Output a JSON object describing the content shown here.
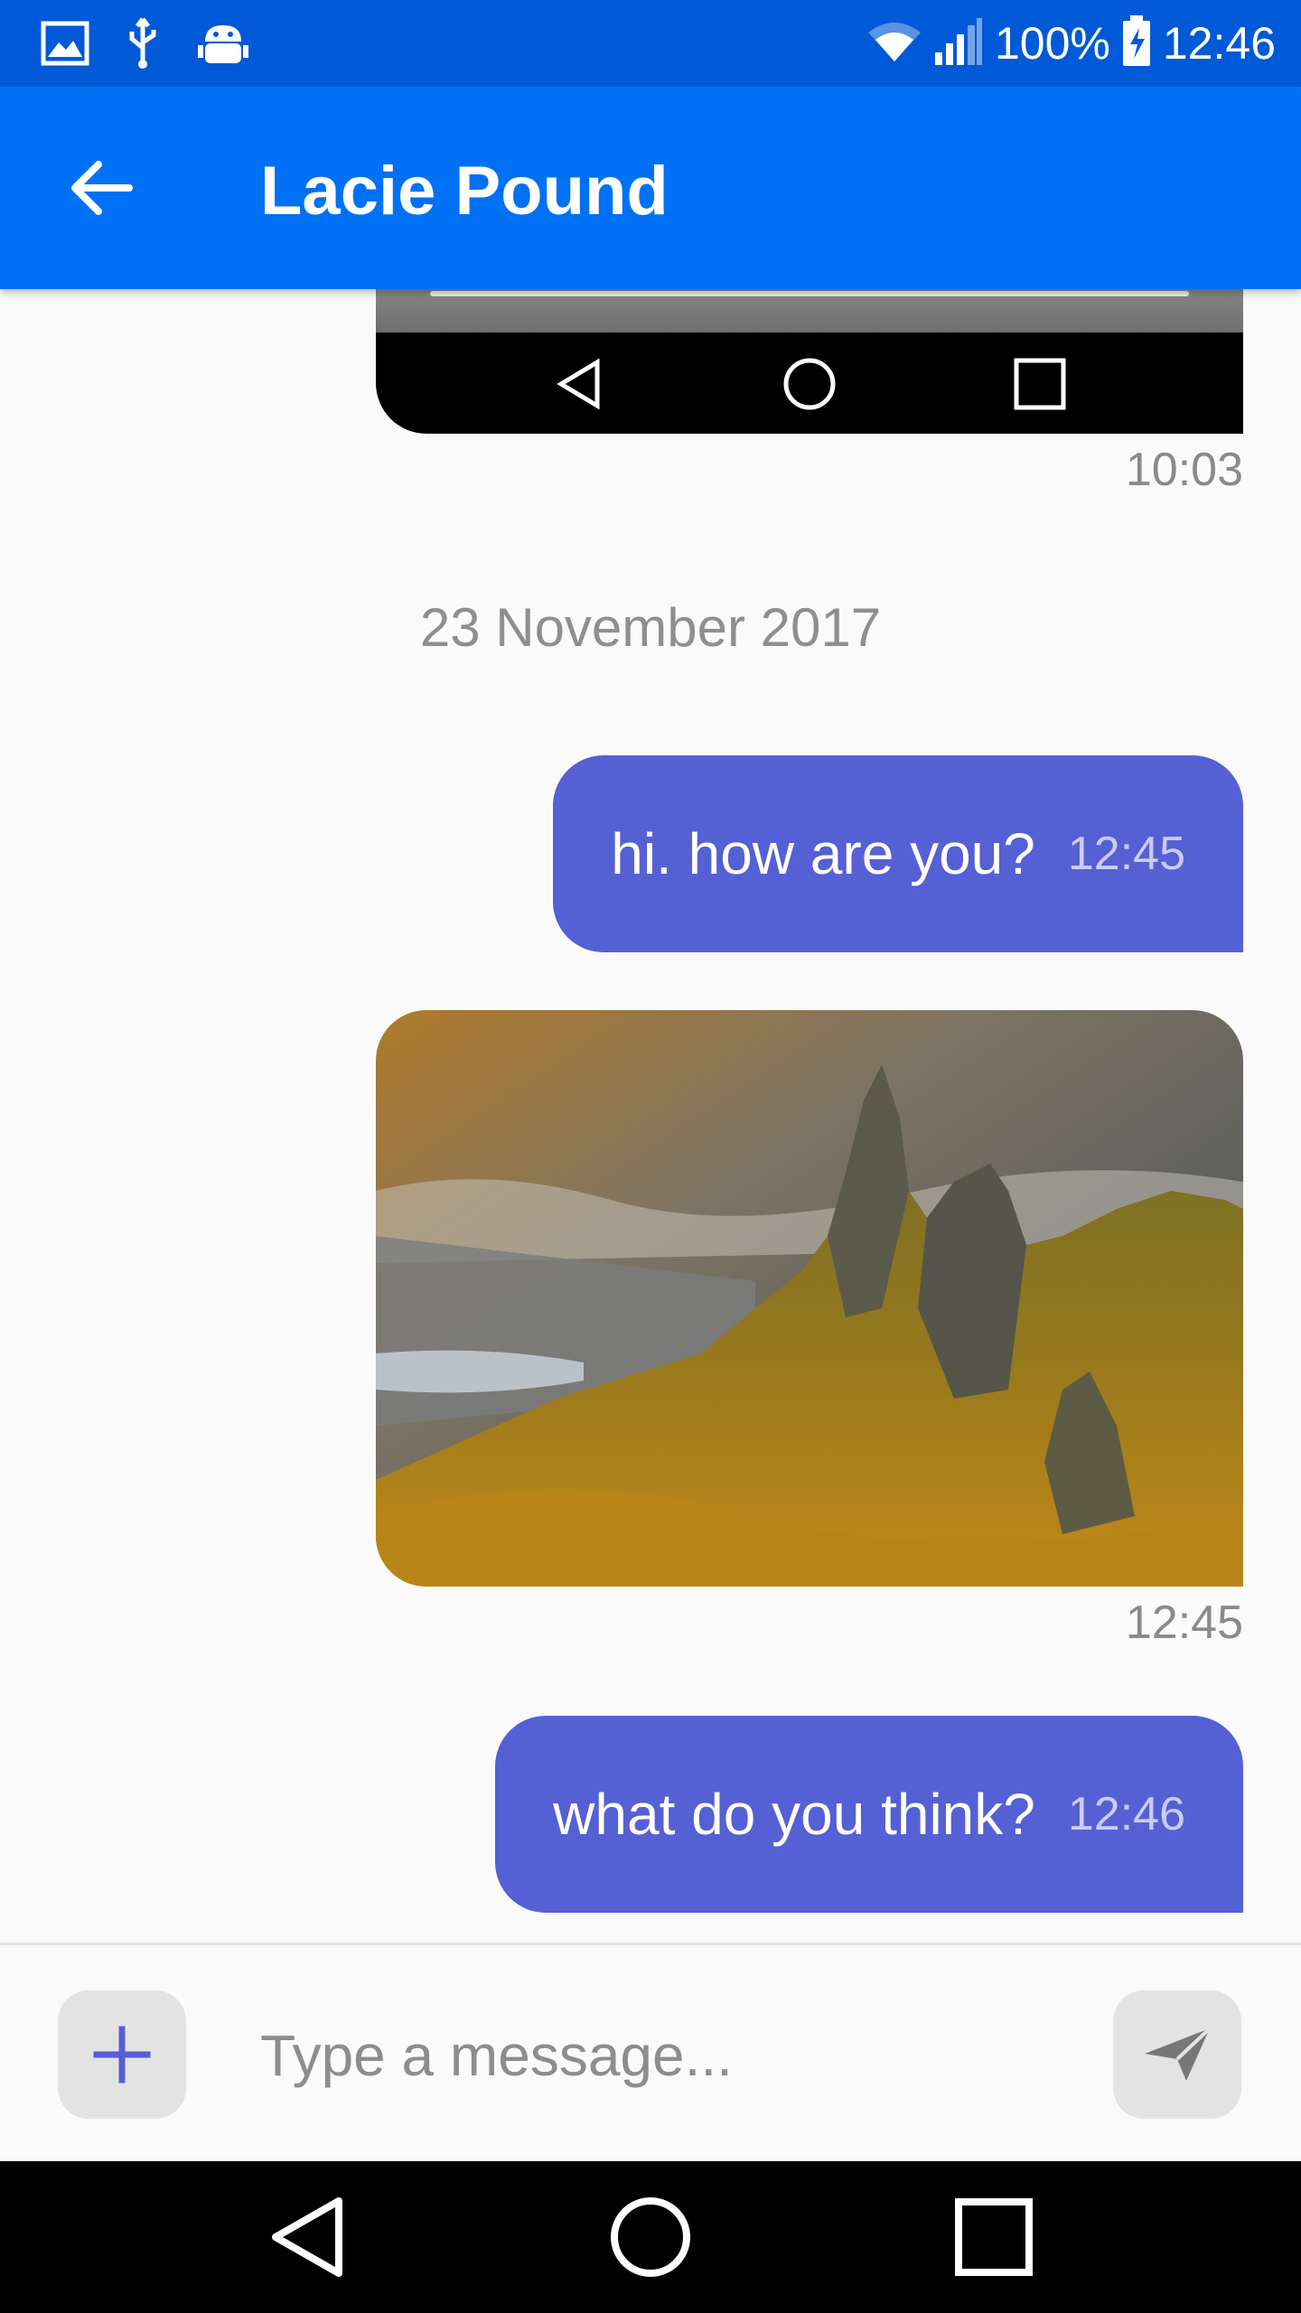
{
  "status_bar": {
    "battery": "100%",
    "time": "12:46",
    "icons": [
      "image-icon",
      "usb-icon",
      "android-debug-icon",
      "wifi-icon",
      "signal-icon",
      "battery-charging-icon"
    ]
  },
  "app_bar": {
    "title": "Lacie Pound",
    "back_icon": "arrow-left-icon"
  },
  "messages": {
    "prev_image_time": "10:03",
    "date_separator": "23 November 2017",
    "items": [
      {
        "type": "text",
        "text": "hi. how are you?",
        "time": "12:45"
      },
      {
        "type": "image",
        "description_icon": "landscape-photo",
        "time": "12:45"
      },
      {
        "type": "text",
        "text": "what do you think?",
        "time": "12:46"
      }
    ]
  },
  "composer": {
    "placeholder": "Type a message...",
    "value": "",
    "attach_icon": "plus-icon",
    "send_icon": "send-icon"
  },
  "nav_bar": {
    "icons": [
      "back-triangle-icon",
      "home-circle-icon",
      "recents-square-icon"
    ]
  },
  "colors": {
    "status_bar": "#0059d6",
    "app_bar": "#0071f5",
    "bubble": "#5560d4",
    "accent_plus": "#5560d4"
  }
}
